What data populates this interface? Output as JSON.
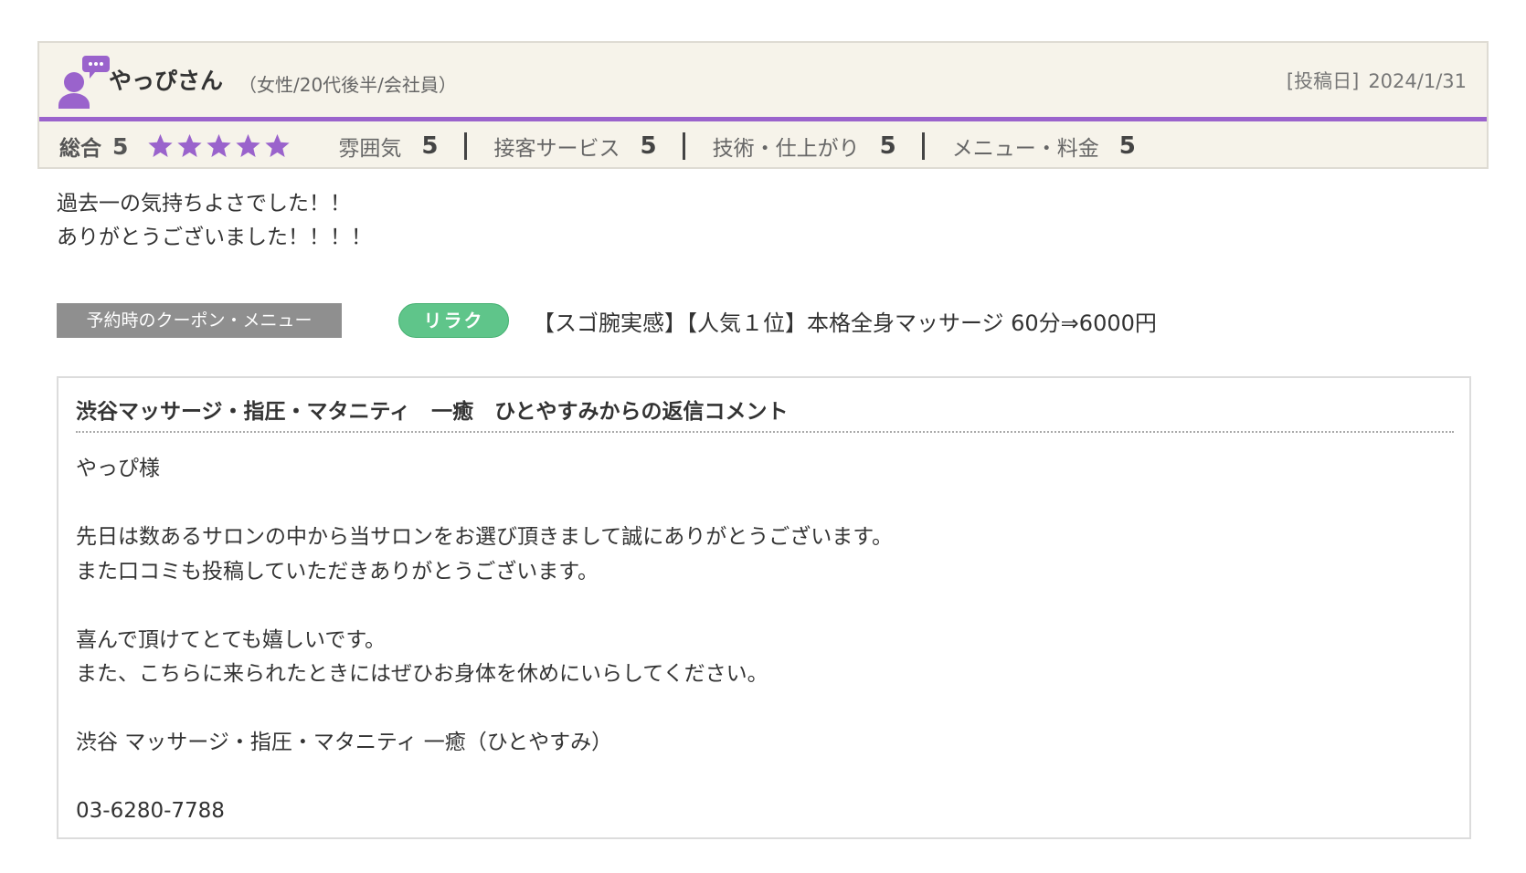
{
  "reviewer": {
    "name": "やっぴさん",
    "meta": "（女性/20代後半/会社員）",
    "post_date_label": "[投稿日]",
    "post_date": "2024/1/31"
  },
  "ratings": {
    "overall_label": "総合",
    "overall_value": "5",
    "stars": 5,
    "star_color": "#9a63cc",
    "items": [
      {
        "label": "雰囲気",
        "value": "5"
      },
      {
        "label": "接客サービス",
        "value": "5"
      },
      {
        "label": "技術・仕上がり",
        "value": "5"
      },
      {
        "label": "メニュー・料金",
        "value": "5"
      }
    ]
  },
  "review_body": [
    "過去一の気持ちよさでした！！",
    "ありがとうございました！！！！"
  ],
  "coupon": {
    "label": "予約時のクーポン・メニュー",
    "badge": "リラク",
    "name": "【スゴ腕実感】【人気１位】本格全身マッサージ 60分⇒6000円"
  },
  "reply": {
    "title": "渋谷マッサージ・指圧・マタニティ　一癒　ひとやすみからの返信コメント",
    "lines": [
      "やっぴ様",
      "",
      "先日は数あるサロンの中から当サロンをお選び頂きまして誠にありがとうございます。",
      "また口コミも投稿していただきありがとうございます。",
      "",
      "喜んで頂けてとても嬉しいです。",
      "また、こちらに来られたときにはぜひお身体を休めにいらしてください。",
      "",
      "渋谷 マッサージ・指圧・マタニティ 一癒（ひとやすみ）",
      "",
      "03-6280-7788"
    ]
  },
  "icons": {
    "avatar": "person-chat-icon",
    "star": "star-icon"
  },
  "colors": {
    "accent_purple": "#9a63cc",
    "card_background": "#f6f3ea",
    "coupon_label_bg": "#8f8f8f",
    "badge_green": "#5fc58a"
  }
}
